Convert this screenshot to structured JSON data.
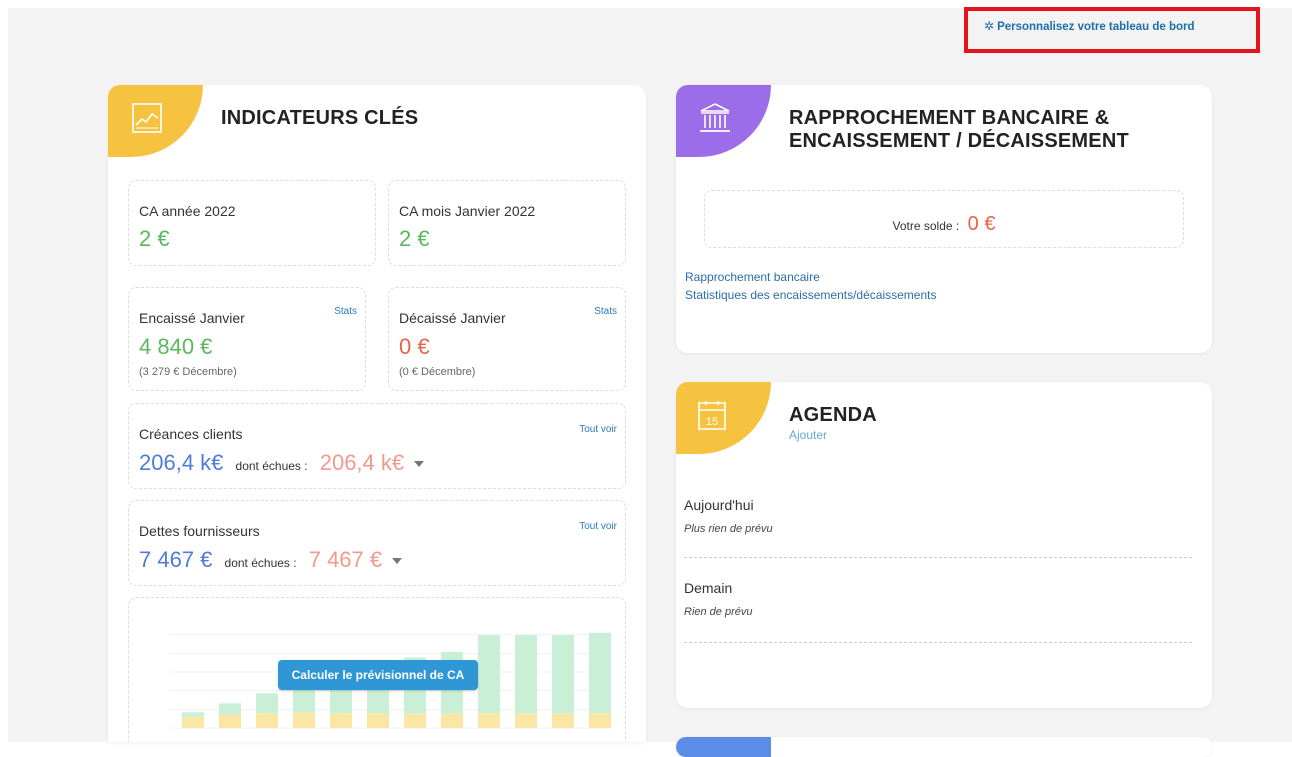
{
  "header": {
    "customize_link": "Personnalisez votre tableau de bord"
  },
  "indicators": {
    "title": "INDICATEURS CLÉS",
    "ca_year": {
      "label": "CA année 2022",
      "value": "2 €"
    },
    "ca_month": {
      "label": "CA mois Janvier 2022",
      "value": "2 €"
    },
    "encaisse": {
      "label": "Encaissé Janvier",
      "value": "4 840 €",
      "sub": "(3 279 € Décembre)",
      "stats_link": "Stats"
    },
    "decaisse": {
      "label": "Décaissé Janvier",
      "value": "0 €",
      "sub": "(0 € Décembre)",
      "stats_link": "Stats"
    },
    "creances": {
      "label": "Créances clients",
      "value": "206,4 k€",
      "due_label": "dont échues :",
      "due_value": "206,4 k€",
      "see_all": "Tout voir"
    },
    "dettes": {
      "label": "Dettes fournisseurs",
      "value": "7 467 €",
      "due_label": "dont échues :",
      "due_value": "7 467 €",
      "see_all": "Tout voir"
    },
    "forecast_button": "Calculer le prévisionnel de CA"
  },
  "chart_data": {
    "type": "bar",
    "note_stacked": true,
    "categories": [
      "",
      "",
      "",
      "",
      "",
      "",
      "",
      "",
      "",
      "",
      "",
      ""
    ],
    "series": [
      {
        "values": [
          10,
          12,
          13,
          14,
          13,
          13,
          13,
          13,
          13,
          13,
          13,
          13
        ]
      },
      {
        "values": [
          4,
          10,
          18,
          24,
          30,
          40,
          50,
          55,
          70,
          70,
          70,
          72
        ]
      }
    ],
    "colors": [
      "#fbe6a6",
      "#c9f0d6"
    ],
    "ylim": [
      0,
      100
    ]
  },
  "bank": {
    "title_line1": "RAPPROCHEMENT BANCAIRE &",
    "title_line2": "ENCAISSEMENT / DÉCAISSEMENT",
    "balance_label": "Votre solde :",
    "balance_value": "0 €",
    "link_reconciliation": "Rapprochement bancaire",
    "link_stats": "Statistiques des encaissements/décaissements"
  },
  "agenda": {
    "title": "AGENDA",
    "add_link": "Ajouter",
    "calendar_day": "15",
    "today_label": "Aujourd'hui",
    "today_note": "Plus rien de prévu",
    "tomorrow_label": "Demain",
    "tomorrow_note": "Rien de prévu"
  },
  "colors": {
    "indicators_badge": "#f5c33f",
    "bank_badge": "#9b6de8",
    "agenda_badge": "#f5c33f",
    "bottom_badge": "#5b8de8",
    "highlight": "#e3141b"
  }
}
